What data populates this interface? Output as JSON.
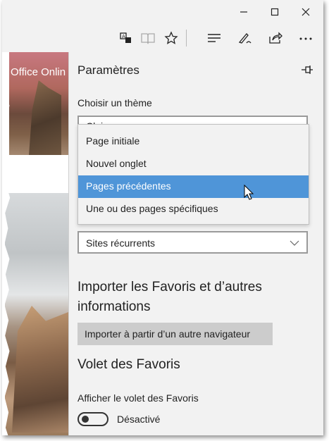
{
  "window": {
    "minimize_icon": "minimize-icon",
    "maximize_icon": "maximize-icon",
    "close_icon": "close-icon"
  },
  "toolbar": {
    "icons": [
      "translate-icon",
      "reading-view-icon",
      "favorite-star-icon",
      "hub-icon",
      "web-note-icon",
      "share-icon",
      "more-icon"
    ]
  },
  "page": {
    "tile_text": "Office Onlin"
  },
  "settings": {
    "title": "Paramètres",
    "theme_label": "Choisir un thème",
    "theme_value": "Clair",
    "open_with_options": [
      {
        "label": "Page initiale",
        "selected": false
      },
      {
        "label": "Nouvel onglet",
        "selected": false
      },
      {
        "label": "Pages précédentes",
        "selected": true
      },
      {
        "label": "Une ou des pages spécifiques",
        "selected": false
      }
    ],
    "newtab_value": "Sites récurrents",
    "import_heading_line1": "Importer les Favoris et d’autres",
    "import_heading_line2": "informations",
    "import_button": "Importer à partir d’un autre navigateur",
    "favbar_heading": "Volet des Favoris",
    "favbar_label": "Afficher le volet des Favoris",
    "favbar_toggle_state": "Désactivé"
  },
  "colors": {
    "panel_bg": "#f2f2f2",
    "selected_bg": "#4f95d8",
    "button_bg": "#cccccc"
  }
}
